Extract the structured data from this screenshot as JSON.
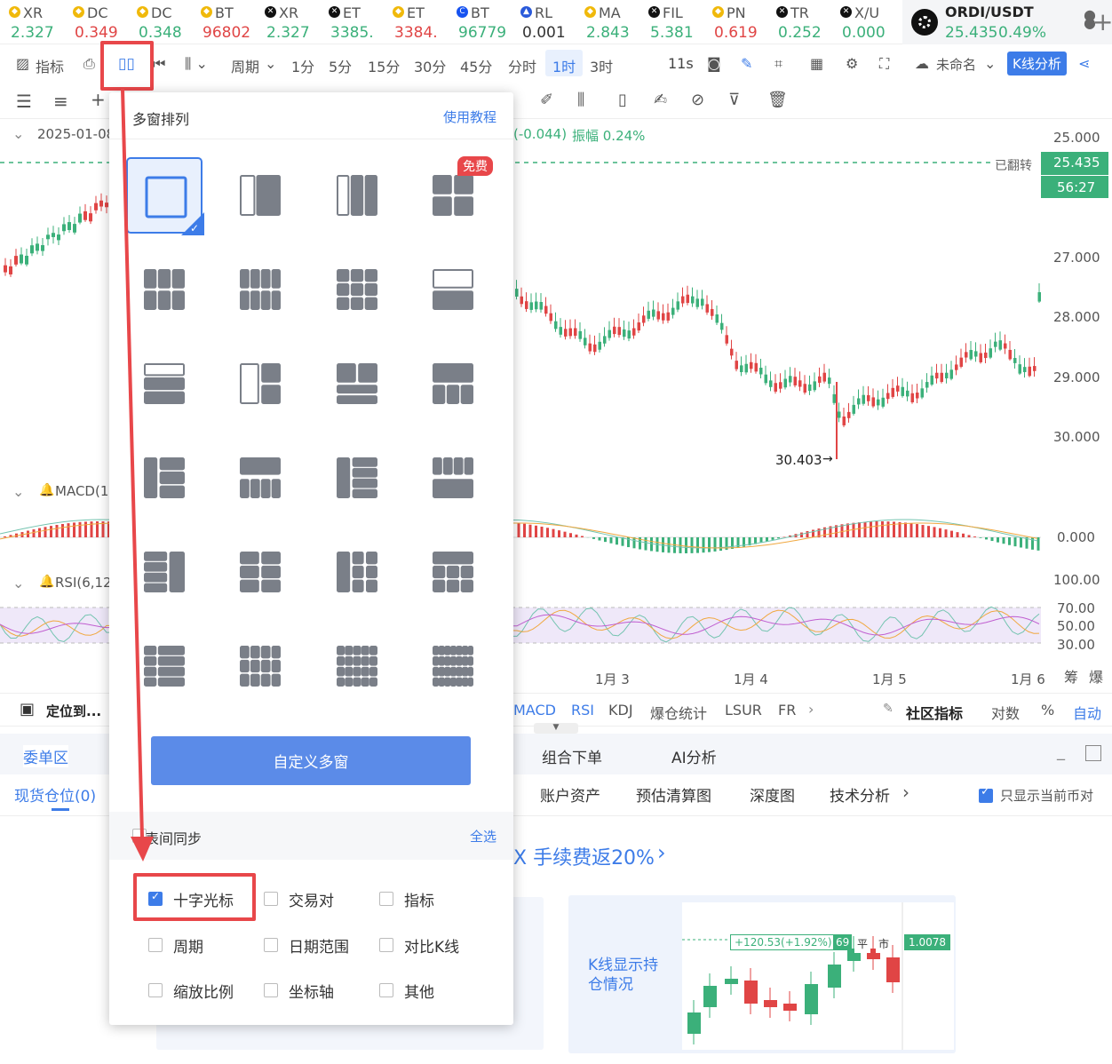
{
  "tickers": [
    {
      "sym": "XR",
      "price": "2.327",
      "color": "up",
      "icon": "bnb-icon"
    },
    {
      "sym": "DC",
      "price": "0.349",
      "color": "dn",
      "icon": "bnb-icon"
    },
    {
      "sym": "DC",
      "price": "0.348",
      "color": "up",
      "icon": "bnb-icon"
    },
    {
      "sym": "BT",
      "price": "96802",
      "color": "dn",
      "icon": "bnb-icon"
    },
    {
      "sym": "XR",
      "price": "2.327",
      "color": "up",
      "icon": "okx-icon"
    },
    {
      "sym": "ET",
      "price": "3385.",
      "color": "up",
      "icon": "okx-icon"
    },
    {
      "sym": "ET",
      "price": "3384.",
      "color": "dn",
      "icon": "bnb-icon"
    },
    {
      "sym": "BT",
      "price": "96779",
      "color": "up",
      "icon": "coinbase-icon"
    },
    {
      "sym": "RL",
      "price": "0.001",
      "color": "nt",
      "icon": "drop-icon"
    },
    {
      "sym": "MA",
      "price": "2.843",
      "color": "up",
      "icon": "bnb-icon"
    },
    {
      "sym": "FIL",
      "price": "5.381",
      "color": "up",
      "icon": "okx-icon"
    },
    {
      "sym": "PN",
      "price": "0.619",
      "color": "dn",
      "icon": "bnb-icon"
    },
    {
      "sym": "TR",
      "price": "0.252",
      "color": "up",
      "icon": "okx-icon"
    },
    {
      "sym": "X/U",
      "price": "0.000",
      "color": "up",
      "icon": "okx-icon"
    }
  ],
  "active_pair": {
    "name": "ORDI/USDT",
    "price": "25.435",
    "change": "0.49%"
  },
  "toolbar": {
    "indicator": "指标",
    "period": "周期",
    "intervals": [
      "1分",
      "5分",
      "15分",
      "30分",
      "45分",
      "分时",
      "1时",
      "3时"
    ],
    "active_interval": "1时",
    "countdown": "11s",
    "unnamed": "未命名",
    "kline_analysis": "K线分析"
  },
  "chart": {
    "date": "2025-01-08",
    "change_text": "(-0.044)",
    "amplitude": "振幅 0.24%",
    "y_labels": [
      "25.000",
      "27.000",
      "28.000",
      "29.000",
      "30.000"
    ],
    "flip_label": "已翻转",
    "last_price": "25.435",
    "countdown": "56:27",
    "low_mark": "30.403",
    "macd_label": "MACD(1",
    "macd_zero": "0.000",
    "rsi_label": "RSI(6,12",
    "rsi_levels": [
      "100.00",
      "70.00",
      "50.00",
      "30.00"
    ],
    "x_labels": [
      "1月 3",
      "1月 4",
      "1月 5",
      "1月 6"
    ],
    "x_extra": [
      "筹",
      "爆"
    ]
  },
  "bottom_bar": {
    "locate": "定位到...",
    "indicators": [
      "MACD",
      "RSI",
      "KDJ",
      "爆仓统计",
      "LSUR",
      "FR"
    ],
    "community": "社区指标",
    "log": "对数",
    "percent": "%",
    "auto": "自动"
  },
  "panel": {
    "tabs_left": [
      "委单区"
    ],
    "tabs_right": [
      "组合下单",
      "AI分析"
    ],
    "subtabs_left": [
      "现货仓位(0)"
    ],
    "subtabs_right": [
      "账户资产",
      "预估清算图",
      "深度图",
      "技术分析"
    ],
    "only_current": "只显示当前币对",
    "promo": "X 手续费返20%",
    "promo_card": "K线显示持仓情况",
    "promo_delta": "+120.53(+1.92%)",
    "promo_badge": "69",
    "promo_flat": "平",
    "promo_market": "市",
    "promo_price": "1.0078"
  },
  "popup": {
    "title": "多窗排列",
    "tutorial": "使用教程",
    "free_badge": "免费",
    "custom_button": "自定义多窗",
    "sync_title": "表间同步",
    "select_all": "全选",
    "options": [
      {
        "label": "十字光标",
        "checked": true
      },
      {
        "label": "交易对",
        "checked": false
      },
      {
        "label": "指标",
        "checked": false
      },
      {
        "label": "周期",
        "checked": false
      },
      {
        "label": "日期范围",
        "checked": false
      },
      {
        "label": "对比K线",
        "checked": false
      },
      {
        "label": "缩放比例",
        "checked": false
      },
      {
        "label": "坐标轴",
        "checked": false
      },
      {
        "label": "其他",
        "checked": false
      }
    ]
  },
  "colors": {
    "accent": "#3d7ce8",
    "up": "#3bb07a",
    "down": "#e04545",
    "highlight": "#e8474a"
  }
}
